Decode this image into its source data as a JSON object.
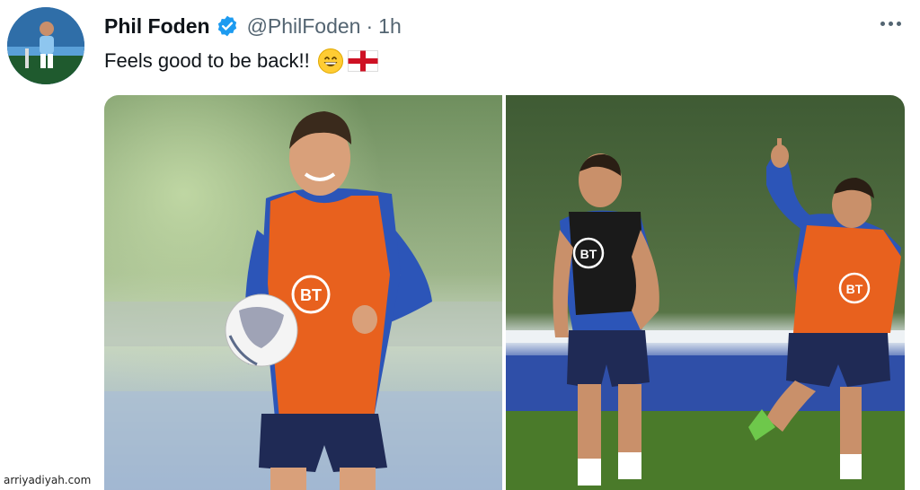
{
  "tweet": {
    "display_name": "Phil Foden",
    "handle": "@PhilFoden",
    "separator": "·",
    "time": "1h",
    "text": "Feels good to be back!!",
    "emojis": [
      "grinning-face-emoji",
      "england-flag-emoji"
    ],
    "badge": "verified-badge-icon"
  },
  "photos": [
    {
      "name": "photo-player-holding-ball",
      "bib_logo": "BT"
    },
    {
      "name": "photo-players-celebrating",
      "bib_logos": [
        "BT",
        "BT"
      ]
    }
  ],
  "watermark": "arriyadiyah.com",
  "colors": {
    "text_primary": "#0f1419",
    "text_secondary": "#536471",
    "verified_blue": "#1d9bf0",
    "bib_orange": "#e8611e",
    "kit_blue": "#2c55b8"
  }
}
